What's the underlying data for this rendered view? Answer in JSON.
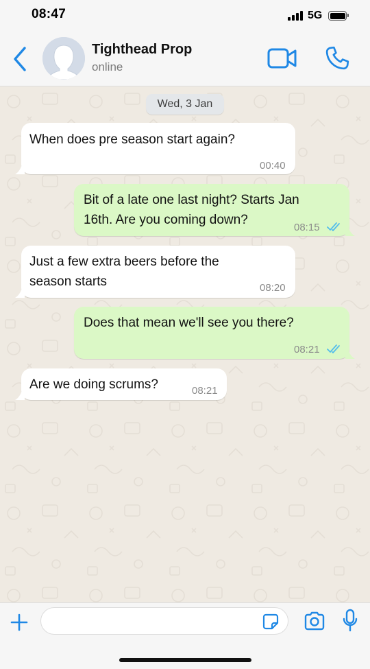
{
  "status_bar": {
    "time": "08:47",
    "network": "5G"
  },
  "header": {
    "contact_name": "Tighthead Prop",
    "contact_status": "online",
    "accent_color": "#1f88e5"
  },
  "chat": {
    "date_separator": "Wed, 3 Jan",
    "colors": {
      "incoming": "#ffffff",
      "outgoing": "#dbf8c6",
      "read_ticks": "#53bdeb"
    },
    "messages": [
      {
        "direction": "in",
        "lines": [
          "When does pre season start again?"
        ],
        "time": "00:40"
      },
      {
        "direction": "out",
        "lines": [
          "Bit of a late one last night? Starts Jan",
          "16th. Are you coming down?"
        ],
        "time": "08:15",
        "read": true
      },
      {
        "direction": "in",
        "lines": [
          "Just a few extra beers before the",
          "season starts"
        ],
        "time": "08:20"
      },
      {
        "direction": "out",
        "lines": [
          "Does that mean we'll see you there?"
        ],
        "time": "08:21",
        "read": true
      },
      {
        "direction": "in",
        "lines": [
          "Are we doing scrums?"
        ],
        "time": "08:21"
      }
    ]
  },
  "composer": {
    "input_value": "",
    "icons": [
      "plus-icon",
      "sticker-icon",
      "camera-icon",
      "microphone-icon"
    ]
  }
}
